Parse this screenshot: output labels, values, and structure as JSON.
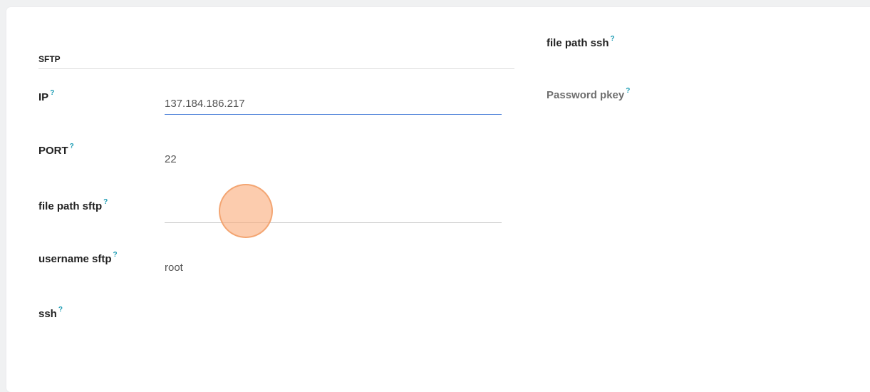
{
  "section": {
    "title": "SFTP"
  },
  "help_mark": "?",
  "fields": {
    "ip": {
      "label": "IP",
      "value": "137.184.186.217"
    },
    "port": {
      "label": "PORT",
      "value": "22"
    },
    "file_path_sftp": {
      "label": "file path sftp",
      "value": ""
    },
    "username_sftp": {
      "label": "username sftp",
      "value": "root"
    },
    "ssh": {
      "label": "ssh"
    },
    "file_path_ssh": {
      "label": "file path ssh"
    },
    "password_pkey": {
      "label": "Password pkey"
    }
  },
  "colors": {
    "help_icon": "#1a9bb3",
    "active_underline": "#4a7fd8",
    "click_indicator": "#f7b489"
  }
}
